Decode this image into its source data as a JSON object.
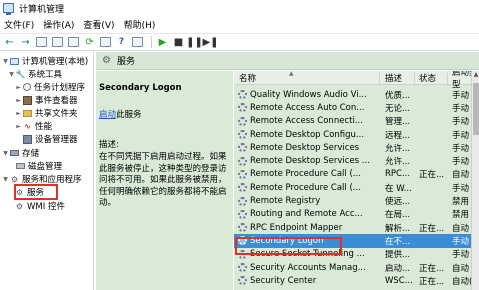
{
  "window": {
    "title": "计算机管理"
  },
  "menu": [
    "文件(F)",
    "操作(A)",
    "查看(V)",
    "帮助(H)"
  ],
  "tree": [
    {
      "label": "计算机管理(本地)",
      "icon": "computer-icon",
      "expander": "chevron-down"
    },
    {
      "label": "系统工具",
      "icon": "tools-icon",
      "expander": "chevron-down"
    },
    {
      "label": "任务计划程序",
      "icon": "clock-icon",
      "expander": "chevron-right"
    },
    {
      "label": "事件查看器",
      "icon": "event-log-icon",
      "expander": "chevron-right"
    },
    {
      "label": "共享文件夹",
      "icon": "shared-folder-icon",
      "expander": "chevron-right"
    },
    {
      "label": "性能",
      "icon": "performance-icon",
      "expander": "chevron-right"
    },
    {
      "label": "设备管理器",
      "icon": "device-manager-icon",
      "expander": ""
    },
    {
      "label": "存储",
      "icon": "storage-icon",
      "expander": "chevron-down"
    },
    {
      "label": "磁盘管理",
      "icon": "disk-icon",
      "expander": ""
    },
    {
      "label": "服务和应用程序",
      "icon": "services-apps-icon",
      "expander": "chevron-down"
    },
    {
      "label": "服务",
      "icon": "services-gear-icon",
      "expander": "",
      "selected": true
    },
    {
      "label": "WMI 控件",
      "icon": "wmi-icon",
      "expander": ""
    }
  ],
  "header": {
    "title": "服务"
  },
  "detail": {
    "service_name": "Secondary Logon",
    "start_link": "启动",
    "start_suffix": "此服务",
    "description_label": "描述:",
    "description_text": "在不同凭据下启用启动过程。如果此服务被停止，这种类型的登录访问将不可用。如果此服务被禁用，任何明确依赖它的服务都将不能启动。"
  },
  "columns": [
    "名称",
    "描述",
    "状态",
    "启动类型"
  ],
  "services": [
    {
      "name": "Quality Windows Audio Vi...",
      "desc": "优质...",
      "status": "",
      "startup": "手动"
    },
    {
      "name": "Remote Access Auto Con...",
      "desc": "无论...",
      "status": "",
      "startup": "手动"
    },
    {
      "name": "Remote Access Connecti...",
      "desc": "管理...",
      "status": "",
      "startup": "手动"
    },
    {
      "name": "Remote Desktop Configu...",
      "desc": "远程...",
      "status": "",
      "startup": "手动"
    },
    {
      "name": "Remote Desktop Services",
      "desc": "允许...",
      "status": "",
      "startup": "手动"
    },
    {
      "name": "Remote Desktop Services ...",
      "desc": "允许...",
      "status": "",
      "startup": "手动"
    },
    {
      "name": "Remote Procedure Call (...",
      "desc": "RPC...",
      "status": "正在...",
      "startup": "自动"
    },
    {
      "name": "Remote Procedure Call (...",
      "desc": "在 W...",
      "status": "",
      "startup": "手动"
    },
    {
      "name": "Remote Registry",
      "desc": "使远...",
      "status": "",
      "startup": "禁用"
    },
    {
      "name": "Routing and Remote Acc...",
      "desc": "在局...",
      "status": "",
      "startup": "禁用"
    },
    {
      "name": "RPC Endpoint Mapper",
      "desc": "解析...",
      "status": "正在...",
      "startup": "自动"
    },
    {
      "name": "Secondary Logon",
      "desc": "在不...",
      "status": "",
      "startup": "手动",
      "selected": true
    },
    {
      "name": "Secure Socket Tunneling ...",
      "desc": "提供...",
      "status": "",
      "startup": "手动"
    },
    {
      "name": "Security Accounts Manag...",
      "desc": "启动...",
      "status": "正在...",
      "startup": "自动"
    },
    {
      "name": "Security Center",
      "desc": "WSC...",
      "status": "正在...",
      "startup": "自动(延迟..."
    }
  ],
  "toolbar_icons": [
    "back-arrow-icon",
    "forward-arrow-icon",
    "up-folder-icon",
    "console-tree-icon",
    "properties-icon",
    "refresh-icon",
    "export-list-icon",
    "help-icon",
    "help-pane-icon",
    "start-service-icon",
    "stop-service-icon",
    "pause-service-icon",
    "restart-service-icon"
  ],
  "colors": {
    "accent_selection": "#3b8ed6",
    "pane_background": "#d9ebd7",
    "highlight_box": "#e0302a",
    "link": "#1a55b8"
  }
}
